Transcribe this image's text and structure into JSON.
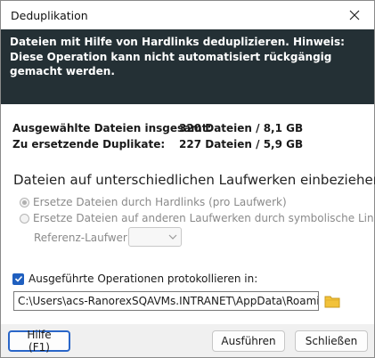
{
  "window": {
    "title": "Deduplikation"
  },
  "banner": {
    "text": "Dateien mit Hilfe von Hardlinks deduplizieren. Hinweis: Diese Operation kann nicht automatisiert rückgängig gemacht werden."
  },
  "stats": {
    "selected_label": "Ausgewählte Dateien insgesamt:",
    "selected_value": "320 Dateien / 8,1 GB",
    "duplicates_label": "Zu ersetzende Duplikate:",
    "duplicates_value": "227 Dateien / 5,9 GB"
  },
  "drives": {
    "section_title": "Dateien auf unterschiedlichen Laufwerken einbeziehen",
    "option_hardlinks": "Ersetze Dateien durch Hardlinks (pro Laufwerk)",
    "option_symlinks": "Ersetze Dateien auf anderen Laufwerken durch symbolische Links",
    "reference_label": "Referenz-Laufwerk:",
    "reference_value": ""
  },
  "log": {
    "checkbox_label": "Ausgeführte Operationen protokollieren in:",
    "checked": true,
    "path": "C:\\Users\\acs-RanorexSQAVMs.INTRANET\\AppData\\Roaming\\JAI"
  },
  "footer": {
    "help_label": "Hilfe (F1)",
    "run_label": "Ausführen",
    "close_label": "Schließen"
  },
  "colors": {
    "banner_bg": "#243035",
    "accent": "#1f5fbf",
    "folder": "#f2c23a"
  }
}
